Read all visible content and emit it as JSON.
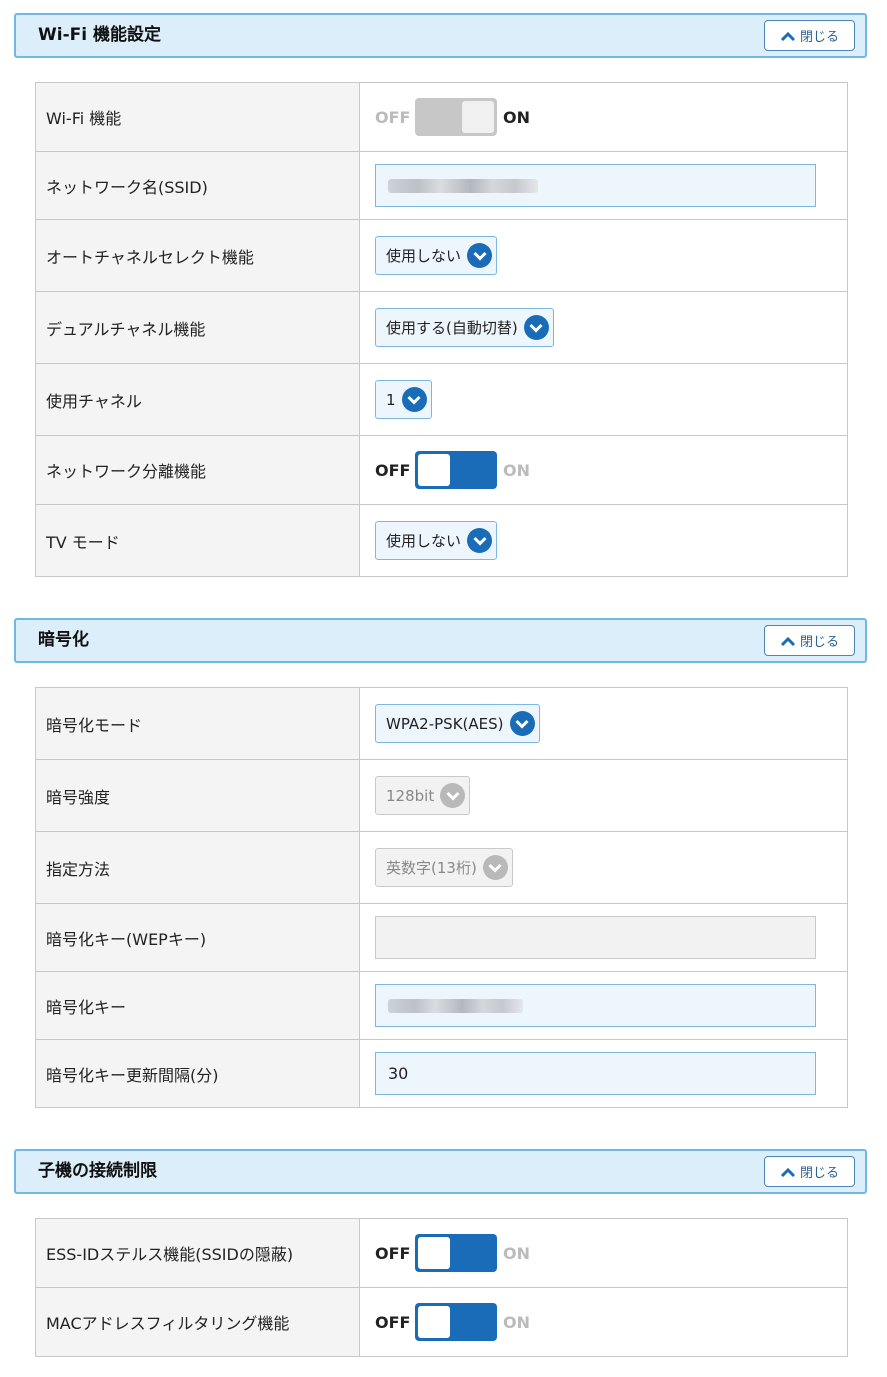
{
  "close_label": "閉じる",
  "colors": {
    "accent": "#1a6cb8",
    "header_bg": "#ddeefb",
    "header_border": "#6fb9e8",
    "field_bg": "#eef6fd"
  },
  "wifi": {
    "title": "Wi-Fi 機能設定",
    "rows": {
      "wifi_function": {
        "label": "Wi-Fi 機能",
        "off": "OFF",
        "on": "ON"
      },
      "ssid": {
        "label": "ネットワーク名(SSID)"
      },
      "auto_channel": {
        "label": "オートチャネルセレクト機能",
        "value": "使用しない"
      },
      "dual_channel": {
        "label": "デュアルチャネル機能",
        "value": "使用する(自動切替)"
      },
      "channel": {
        "label": "使用チャネル",
        "value": "1"
      },
      "network_separation": {
        "label": "ネットワーク分離機能",
        "off": "OFF",
        "on": "ON"
      },
      "tv_mode": {
        "label": "TV モード",
        "value": "使用しない"
      }
    }
  },
  "encryption": {
    "title": "暗号化",
    "rows": {
      "mode": {
        "label": "暗号化モード",
        "value": "WPA2-PSK(AES)"
      },
      "strength": {
        "label": "暗号強度",
        "value": "128bit"
      },
      "method": {
        "label": "指定方法",
        "value": "英数字(13桁)"
      },
      "wep_key": {
        "label": "暗号化キー(WEPキー)",
        "value": ""
      },
      "key": {
        "label": "暗号化キー"
      },
      "key_interval": {
        "label": "暗号化キー更新間隔(分)",
        "value": "30"
      }
    }
  },
  "client_limit": {
    "title": "子機の接続制限",
    "rows": {
      "stealth": {
        "label": "ESS-IDステルス機能(SSIDの隠蔽)",
        "off": "OFF",
        "on": "ON"
      },
      "mac_filter": {
        "label": "MACアドレスフィルタリング機能",
        "off": "OFF",
        "on": "ON"
      }
    }
  }
}
